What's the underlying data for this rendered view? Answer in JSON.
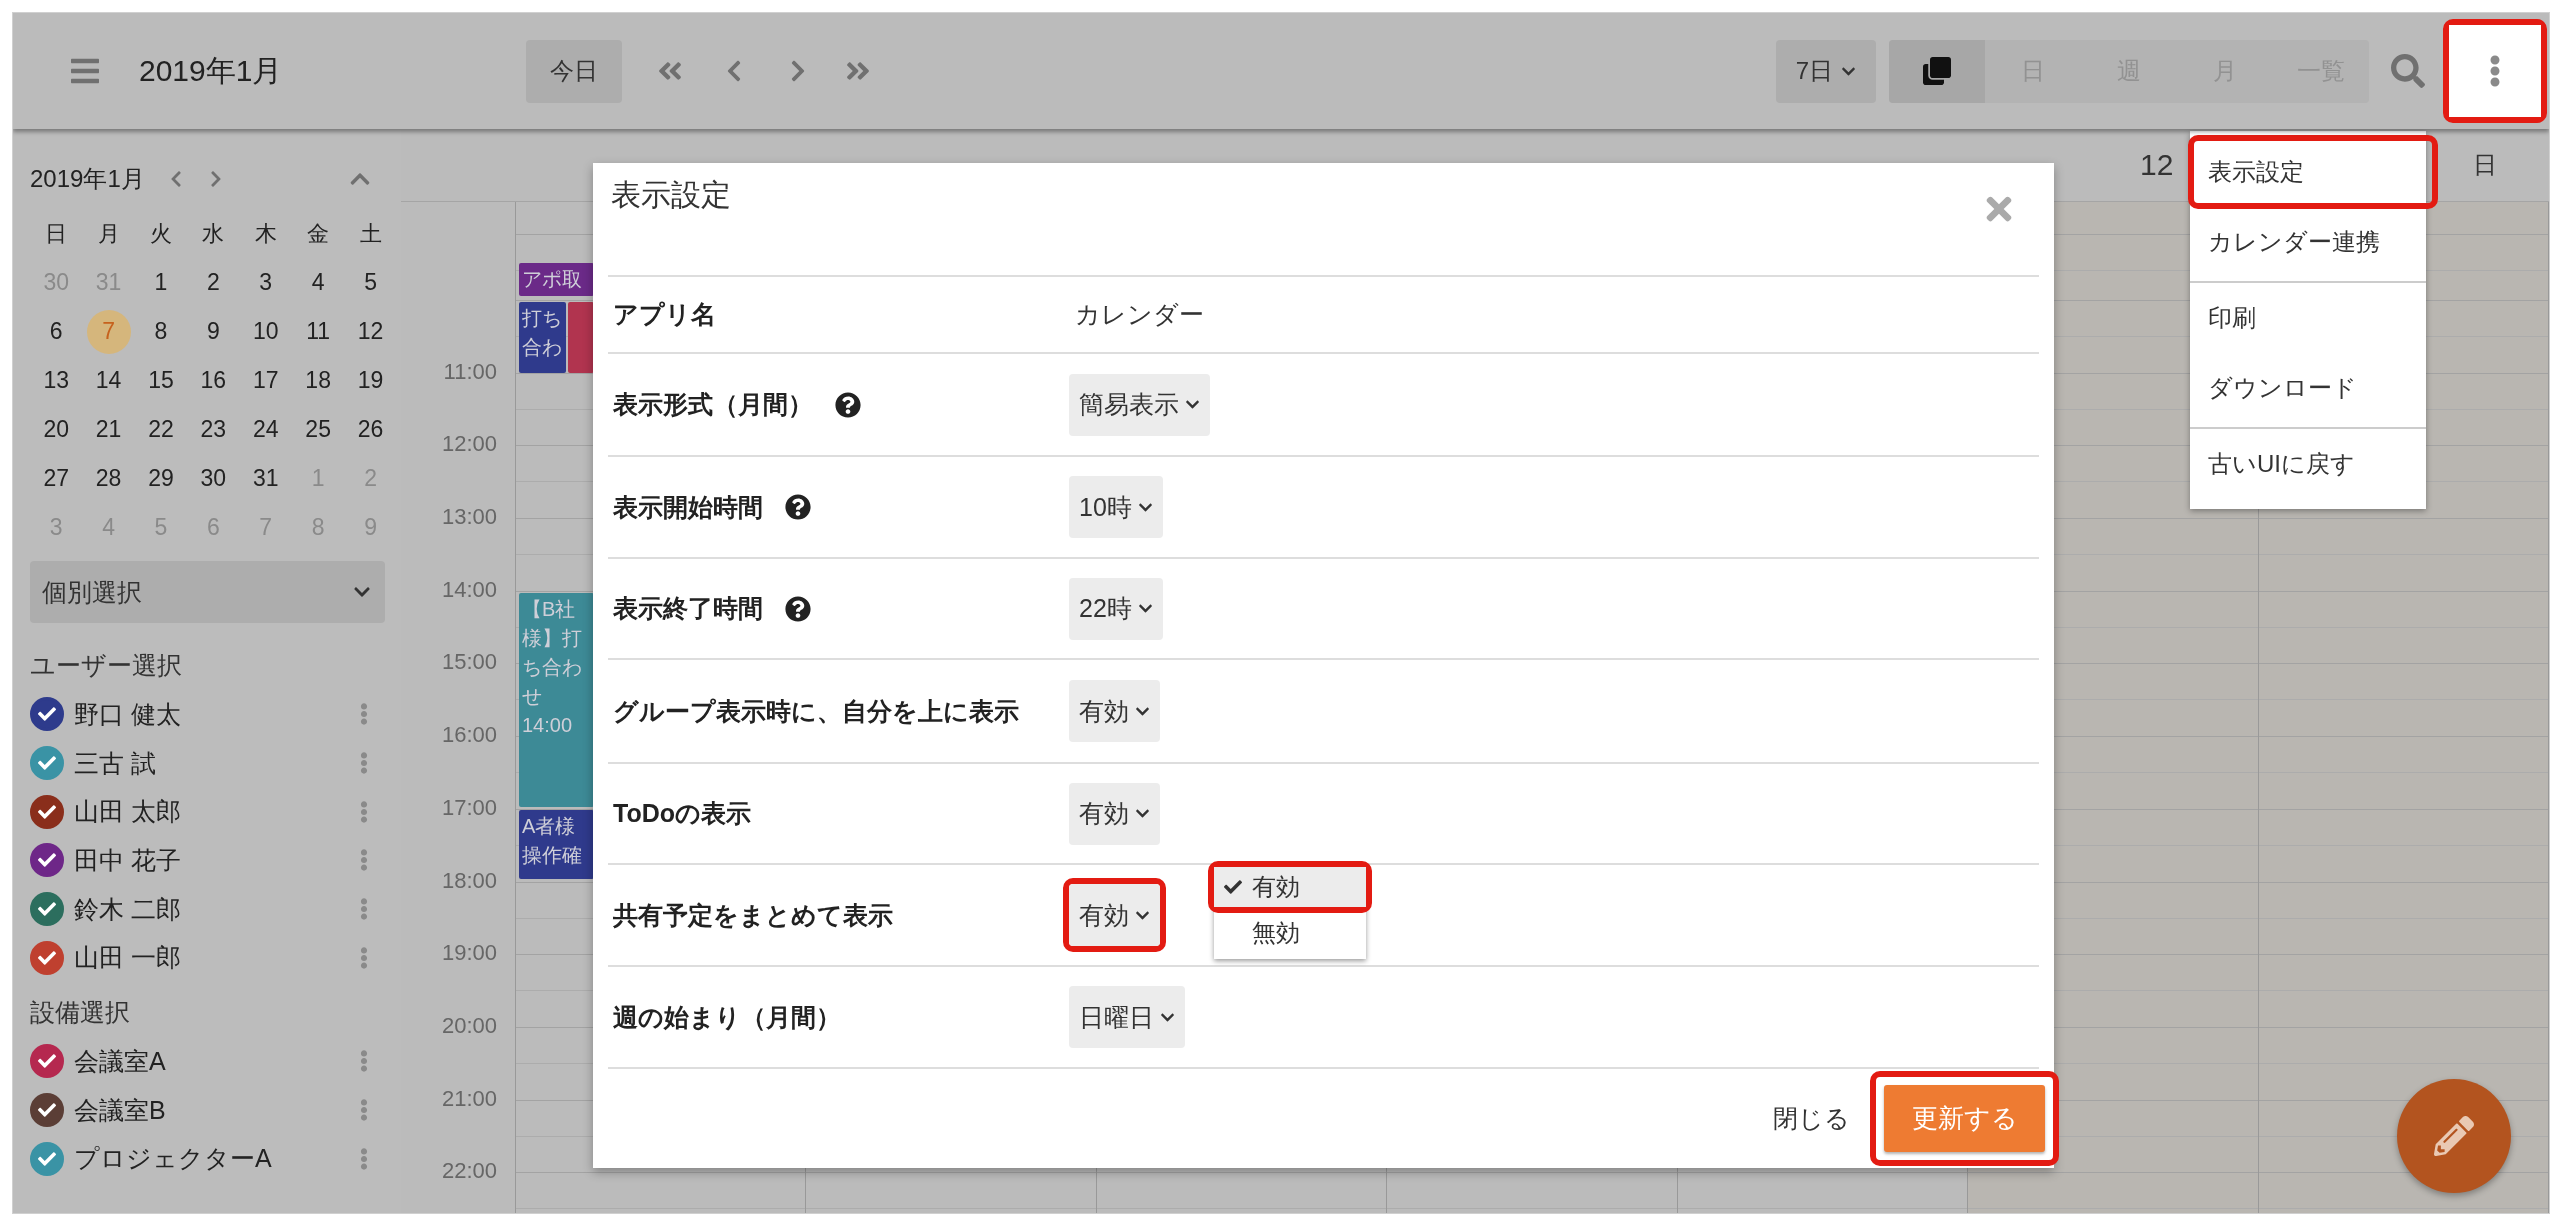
{
  "header": {
    "title": "2019年1月",
    "today_button": "今日",
    "range_select": {
      "value": "7日"
    },
    "views": [
      {
        "kind": "icon",
        "selected": true
      },
      {
        "kind": "text",
        "label": "日",
        "selected": false
      },
      {
        "kind": "text",
        "label": "週",
        "selected": false
      },
      {
        "kind": "text",
        "label": "月",
        "selected": false
      },
      {
        "kind": "text",
        "label": "一覧",
        "selected": false
      }
    ],
    "menu_button": {
      "highlighted": true
    }
  },
  "sidebar": {
    "month_title": "2019年1月",
    "weekdays": [
      "日",
      "月",
      "火",
      "水",
      "木",
      "金",
      "土"
    ],
    "weeks": [
      [
        {
          "label": "30",
          "other_month": true,
          "today": false
        },
        {
          "label": "31",
          "other_month": true,
          "today": false
        },
        {
          "label": "1",
          "other_month": false,
          "today": false
        },
        {
          "label": "2",
          "other_month": false,
          "today": false
        },
        {
          "label": "3",
          "other_month": false,
          "today": false
        },
        {
          "label": "4",
          "other_month": false,
          "today": false
        },
        {
          "label": "5",
          "other_month": false,
          "today": false
        }
      ],
      [
        {
          "label": "6",
          "other_month": false,
          "today": false
        },
        {
          "label": "7",
          "other_month": false,
          "today": true
        },
        {
          "label": "8",
          "other_month": false,
          "today": false
        },
        {
          "label": "9",
          "other_month": false,
          "today": false
        },
        {
          "label": "10",
          "other_month": false,
          "today": false
        },
        {
          "label": "11",
          "other_month": false,
          "today": false
        },
        {
          "label": "12",
          "other_month": false,
          "today": false
        }
      ],
      [
        {
          "label": "13",
          "other_month": false,
          "today": false
        },
        {
          "label": "14",
          "other_month": false,
          "today": false
        },
        {
          "label": "15",
          "other_month": false,
          "today": false
        },
        {
          "label": "16",
          "other_month": false,
          "today": false
        },
        {
          "label": "17",
          "other_month": false,
          "today": false
        },
        {
          "label": "18",
          "other_month": false,
          "today": false
        },
        {
          "label": "19",
          "other_month": false,
          "today": false
        }
      ],
      [
        {
          "label": "20",
          "other_month": false,
          "today": false
        },
        {
          "label": "21",
          "other_month": false,
          "today": false
        },
        {
          "label": "22",
          "other_month": false,
          "today": false
        },
        {
          "label": "23",
          "other_month": false,
          "today": false
        },
        {
          "label": "24",
          "other_month": false,
          "today": false
        },
        {
          "label": "25",
          "other_month": false,
          "today": false
        },
        {
          "label": "26",
          "other_month": false,
          "today": false
        }
      ],
      [
        {
          "label": "27",
          "other_month": false,
          "today": false
        },
        {
          "label": "28",
          "other_month": false,
          "today": false
        },
        {
          "label": "29",
          "other_month": false,
          "today": false
        },
        {
          "label": "30",
          "other_month": false,
          "today": false
        },
        {
          "label": "31",
          "other_month": false,
          "today": false
        },
        {
          "label": "1",
          "other_month": true,
          "today": false
        },
        {
          "label": "2",
          "other_month": true,
          "today": false
        }
      ],
      [
        {
          "label": "3",
          "other_month": true,
          "today": false
        },
        {
          "label": "4",
          "other_month": true,
          "today": false
        },
        {
          "label": "5",
          "other_month": true,
          "today": false
        },
        {
          "label": "6",
          "other_month": true,
          "today": false
        },
        {
          "label": "7",
          "other_month": true,
          "today": false
        },
        {
          "label": "8",
          "other_month": true,
          "today": false
        },
        {
          "label": "9",
          "other_month": true,
          "today": false
        }
      ]
    ],
    "filter_select": {
      "value": "個別選択"
    },
    "sections": [
      {
        "title": "ユーザー選択",
        "items": [
          {
            "name": "野口 健太",
            "color": "#2e3b8c",
            "checked": true
          },
          {
            "name": "三古 試",
            "color": "#3a93a5",
            "checked": true
          },
          {
            "name": "山田 太郎",
            "color": "#8a2e1b",
            "checked": true
          },
          {
            "name": "田中 花子",
            "color": "#6e2788",
            "checked": true
          },
          {
            "name": "鈴木 二郎",
            "color": "#2c6e5e",
            "checked": true
          },
          {
            "name": "山田 一郎",
            "color": "#bf402f",
            "checked": true
          }
        ]
      },
      {
        "title": "設備選択",
        "items": [
          {
            "name": "会議室A",
            "color": "#b5284f",
            "checked": true
          },
          {
            "name": "会議室B",
            "color": "#5b3e36",
            "checked": true
          },
          {
            "name": "プロジェクターA",
            "color": "#3a93a5",
            "checked": true
          }
        ]
      }
    ]
  },
  "calendar": {
    "day_headers": [
      {
        "text": "12"
      },
      {
        "text": "日"
      }
    ],
    "hours": [
      "11:00",
      "12:00",
      "13:00",
      "14:00",
      "15:00",
      "16:00",
      "17:00",
      "18:00",
      "19:00",
      "20:00",
      "21:00",
      "22:00"
    ],
    "events": [
      {
        "lines": [
          "アポ取"
        ],
        "color": "#6b2a88"
      },
      {
        "lines": [
          "打ち",
          "合わ"
        ],
        "color": "#2f3a8c"
      },
      {
        "color": "#b1344f"
      },
      {
        "lines": [
          "【B社",
          "様】打",
          "ち合わ",
          "せ",
          "14:00"
        ],
        "color": "#3d8a96"
      },
      {
        "lines": [
          "A者様",
          "操作確"
        ],
        "color": "#2f3a8c"
      }
    ]
  },
  "menu": {
    "groups": [
      [
        {
          "label": "表示設定",
          "highlighted": true
        },
        {
          "label": "カレンダー連携",
          "highlighted": false
        }
      ],
      [
        {
          "label": "印刷",
          "highlighted": false
        },
        {
          "label": "ダウンロード",
          "highlighted": false
        }
      ],
      [
        {
          "label": "古いUIに戻す",
          "highlighted": false
        }
      ]
    ]
  },
  "dialog": {
    "title": "表示設定",
    "rows": [
      {
        "label": "アプリ名",
        "kind": "text",
        "value": "カレンダー",
        "help": false,
        "highlighted": false
      },
      {
        "label": "表示形式（月間）",
        "kind": "select",
        "value": "簡易表示",
        "help": true,
        "highlighted": false
      },
      {
        "label": "表示開始時間",
        "kind": "select",
        "value": "10時",
        "help": true,
        "highlighted": false
      },
      {
        "label": "表示終了時間",
        "kind": "select",
        "value": "22時",
        "help": true,
        "highlighted": false
      },
      {
        "label": "グループ表示時に、自分を上に表示",
        "kind": "select",
        "value": "有効",
        "help": false,
        "highlighted": false
      },
      {
        "label": "ToDoの表示",
        "kind": "select",
        "value": "有効",
        "help": false,
        "highlighted": false
      },
      {
        "label": "共有予定をまとめて表示",
        "kind": "select",
        "value": "有効",
        "help": false,
        "highlighted": true,
        "options": [
          {
            "label": "有効",
            "selected": true,
            "highlighted": true
          },
          {
            "label": "無効",
            "selected": false,
            "highlighted": false
          }
        ]
      },
      {
        "label": "週の始まり（月間）",
        "kind": "select",
        "value": "日曜日",
        "help": false,
        "highlighted": false
      }
    ],
    "close_button": "閉じる",
    "submit_button": {
      "label": "更新する",
      "highlighted": true
    }
  }
}
